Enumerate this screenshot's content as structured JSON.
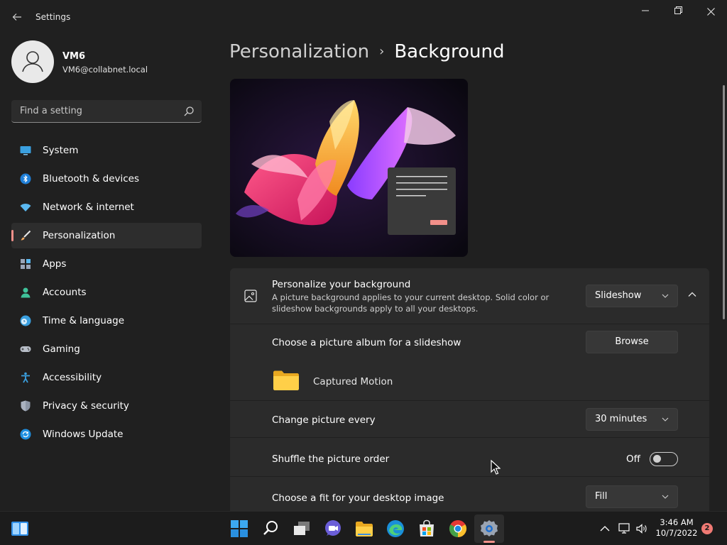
{
  "window": {
    "title": "Settings",
    "back_icon": "back-arrow-icon",
    "controls": [
      "minimize-icon",
      "maximize-icon",
      "close-icon"
    ]
  },
  "profile": {
    "name": "VM6",
    "email": "VM6@collabnet.local"
  },
  "search": {
    "placeholder": "Find a setting",
    "icon": "search-icon"
  },
  "nav": {
    "items": [
      {
        "label": "System",
        "icon": "system-icon",
        "active": false
      },
      {
        "label": "Bluetooth & devices",
        "icon": "bluetooth-icon",
        "active": false
      },
      {
        "label": "Network & internet",
        "icon": "wifi-icon",
        "active": false
      },
      {
        "label": "Personalization",
        "icon": "brush-icon",
        "active": true
      },
      {
        "label": "Apps",
        "icon": "apps-icon",
        "active": false
      },
      {
        "label": "Accounts",
        "icon": "accounts-icon",
        "active": false
      },
      {
        "label": "Time & language",
        "icon": "clock-globe-icon",
        "active": false
      },
      {
        "label": "Gaming",
        "icon": "gamepad-icon",
        "active": false
      },
      {
        "label": "Accessibility",
        "icon": "accessibility-icon",
        "active": false
      },
      {
        "label": "Privacy & security",
        "icon": "shield-icon",
        "active": false
      },
      {
        "label": "Windows Update",
        "icon": "update-icon",
        "active": false
      }
    ]
  },
  "breadcrumb": {
    "parent": "Personalization",
    "separator": "›",
    "current": "Background"
  },
  "background": {
    "title": "Personalize your background",
    "description": "A picture background applies to your current desktop. Solid color or slideshow backgrounds apply to all your desktops.",
    "mode": "Slideshow"
  },
  "slideshow": {
    "album_label": "Choose a picture album for a slideshow",
    "browse_label": "Browse",
    "folder_name": "Captured Motion",
    "change_label": "Change picture every",
    "change_value": "30 minutes",
    "shuffle_label": "Shuffle the picture order",
    "shuffle_state": "Off",
    "fit_label": "Choose a fit for your desktop image",
    "fit_value": "Fill"
  },
  "taskbar": {
    "apps": [
      "widgets-icon",
      "start-icon",
      "search-icon",
      "task-view-icon",
      "chat-icon",
      "file-explorer-icon",
      "edge-icon",
      "store-icon",
      "chrome-icon",
      "settings-icon"
    ],
    "tray": [
      "chevron-up-icon",
      "network-icon",
      "volume-icon"
    ],
    "time": "3:46 AM",
    "date": "10/7/2022",
    "notifications": "2"
  },
  "colors": {
    "accent": "#f2908a",
    "background": "#202020",
    "card": "#2b2b2b"
  }
}
